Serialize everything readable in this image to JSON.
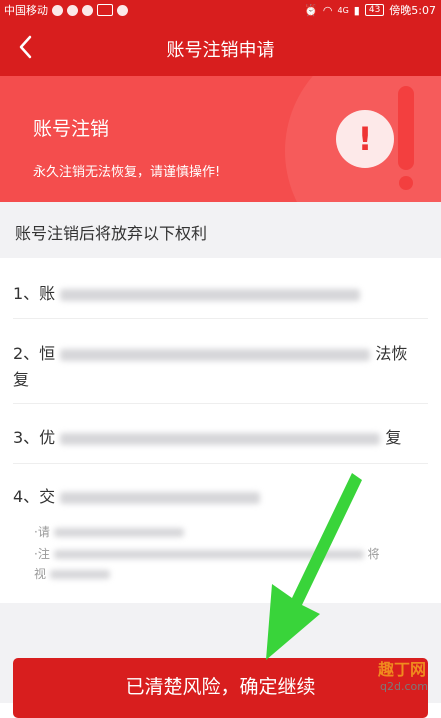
{
  "status_bar": {
    "carrier": "中国移动",
    "time": "傍晚5:07",
    "battery": "43",
    "network": "4G"
  },
  "header": {
    "title": "账号注销申请"
  },
  "hero": {
    "title": "账号注销",
    "subtitle": "永久注销无法恢复，请谨慎操作!"
  },
  "section": {
    "title": "账号注销后将放弃以下权利"
  },
  "items": [
    {
      "prefix": "1、账",
      "line2": ""
    },
    {
      "prefix": "2、恒",
      "suffix": "法恢",
      "line2": "复"
    },
    {
      "prefix": "3、优",
      "suffix": "复"
    },
    {
      "prefix": "4、交",
      "suffix": ""
    }
  ],
  "notes": [
    {
      "prefix": "·请"
    },
    {
      "prefix": "·注",
      "suffix": "将"
    },
    {
      "prefix": "视"
    }
  ],
  "cta_label": "已清楚风险，确定继续",
  "watermark": {
    "brand": "趣丁网",
    "url": "q2d.com"
  },
  "colors": {
    "primary": "#d81e1e",
    "hero": "#f44d4d",
    "arrow": "#39d43a"
  }
}
